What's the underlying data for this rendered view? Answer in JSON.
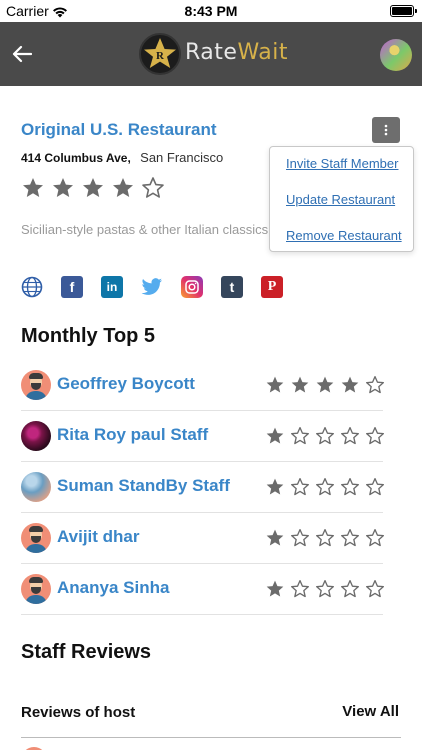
{
  "status_bar": {
    "carrier": "Carrier",
    "time": "8:43 PM"
  },
  "header": {
    "logo_part1": "Rate",
    "logo_part2": "Wait",
    "logo_badge_letter": "R",
    "back_icon": "arrow-left-icon",
    "profile_avatar": "user-avatar"
  },
  "restaurant": {
    "name": "Original U.S. Restaurant",
    "street": "414 Columbus Ave,",
    "city": "San Francisco",
    "rating": 4,
    "rating_max": 5,
    "description": "Sicilian-style pastas & other Italian classics buzzy eatery with wall murals."
  },
  "menu": {
    "items": [
      "Invite Staff Member",
      "Update Restaurant",
      "Remove Restaurant"
    ]
  },
  "social_icons": [
    "globe-icon",
    "facebook-icon",
    "linkedin-icon",
    "twitter-icon",
    "instagram-icon",
    "tumblr-icon",
    "pinterest-icon"
  ],
  "sections": {
    "monthly_top": "Monthly Top 5",
    "staff_reviews": "Staff Reviews",
    "reviews_of_host": "Reviews of host",
    "view_all": "View All"
  },
  "staff": [
    {
      "name": "Geoffrey Boycott",
      "rating": 4,
      "avatar": "person"
    },
    {
      "name": "Rita Roy paul Staff",
      "rating": 1,
      "avatar": "flower"
    },
    {
      "name": "Suman StandBy Staff",
      "rating": 1,
      "avatar": "cloud"
    },
    {
      "name": "Avijit dhar",
      "rating": 1,
      "avatar": "person"
    },
    {
      "name": "Ananya Sinha",
      "rating": 1,
      "avatar": "person"
    }
  ],
  "colors": {
    "nav_bg": "#4a4a4a",
    "link_blue": "#3a86c8",
    "star_filled": "#6b6b6b",
    "logo_gold": "#d7b24a"
  }
}
